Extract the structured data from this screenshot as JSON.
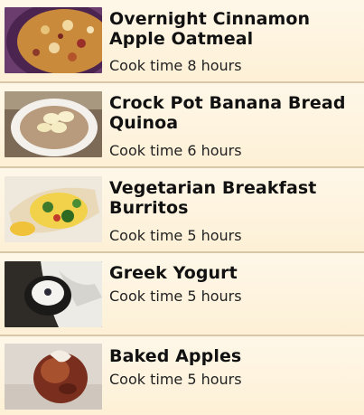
{
  "recipes": [
    {
      "title": "Overnight Cinnamon Apple Oatmeal",
      "cook_time": "Cook time 8 hours",
      "image_icon": "oatmeal-photo"
    },
    {
      "title": "Crock Pot Banana Bread Quinoa",
      "cook_time": "Cook time 6 hours",
      "image_icon": "quinoa-photo"
    },
    {
      "title": "Vegetarian Breakfast Burritos",
      "cook_time": "Cook time 5 hours",
      "image_icon": "burrito-photo"
    },
    {
      "title": " Greek Yogurt",
      "cook_time": "Cook time 5 hours",
      "image_icon": "yogurt-photo"
    },
    {
      "title": "Baked Apples",
      "cook_time": "Cook time 5 hours",
      "image_icon": "baked-apple-photo"
    }
  ]
}
